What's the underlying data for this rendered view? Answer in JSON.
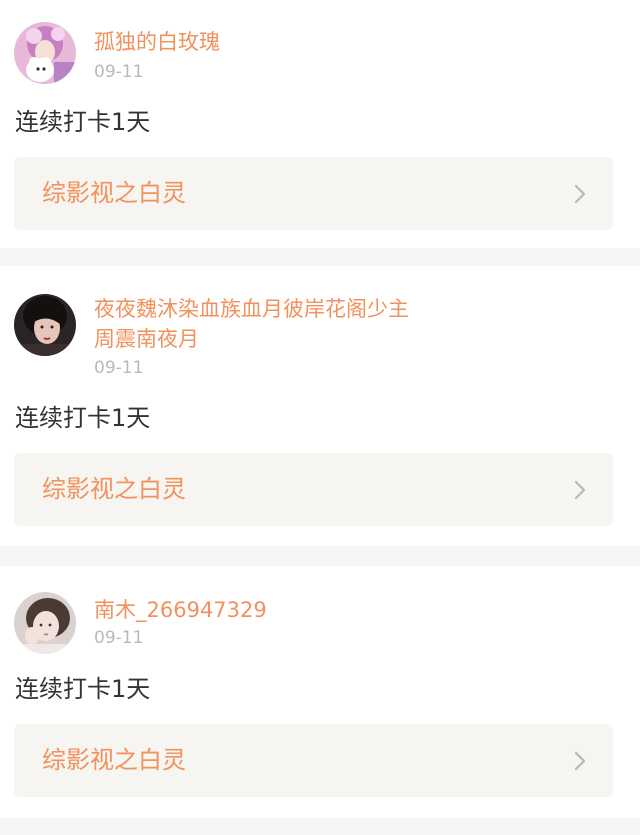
{
  "posts": [
    {
      "username": "孤独的白玫瑰",
      "date": "09-11",
      "text": "连续打卡1天",
      "topic": "综影视之白灵",
      "avatar_icon": "girl-with-bear-avatar"
    },
    {
      "username": "夜夜魏沐染血族血月彼岸花阁少主周震南夜月",
      "date": "09-11",
      "text": "连续打卡1天",
      "topic": "综影视之白灵",
      "avatar_icon": "dark-hair-portrait-avatar"
    },
    {
      "username": "南木_266947329",
      "date": "09-11",
      "text": "连续打卡1天",
      "topic": "综影视之白灵",
      "avatar_icon": "girl-portrait-avatar"
    }
  ],
  "colors": {
    "accent": "#f2915c",
    "date": "#b9b9b9",
    "text": "#333333",
    "topic_bg": "#f6f5f1",
    "divider": "#f5f5f5"
  }
}
